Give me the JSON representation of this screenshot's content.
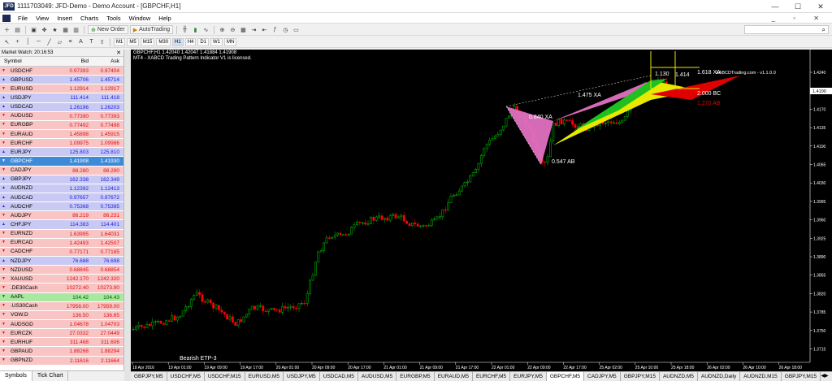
{
  "window": {
    "title": "1111703049: JFD-Demo - Demo Account - [GBPCHF,H1]",
    "logo": "JFD"
  },
  "menu": [
    "File",
    "View",
    "Insert",
    "Charts",
    "Tools",
    "Window",
    "Help"
  ],
  "toolbar1": {
    "new_order": "New Order",
    "auto_trading": "AutoTrading"
  },
  "toolbar2": {
    "timeframes": [
      "M1",
      "M5",
      "M15",
      "M30",
      "H1",
      "H4",
      "D1",
      "W1",
      "MN"
    ],
    "active_timeframe": "H1"
  },
  "market_watch": {
    "title": "Market Watch: 20:16:53",
    "headers": {
      "symbol": "Symbol",
      "bid": "Bid",
      "ask": "Ask"
    },
    "rows": [
      {
        "symbol": "USDCHF",
        "bid": "0.97393",
        "ask": "0.97404",
        "dir": "down"
      },
      {
        "symbol": "GBPUSD",
        "bid": "1.45706",
        "ask": "1.45714",
        "dir": "up"
      },
      {
        "symbol": "EURUSD",
        "bid": "1.12914",
        "ask": "1.12917",
        "dir": "down"
      },
      {
        "symbol": "USDJPY",
        "bid": "111.414",
        "ask": "111.418",
        "dir": "up"
      },
      {
        "symbol": "USDCAD",
        "bid": "1.26196",
        "ask": "1.26203",
        "dir": "up"
      },
      {
        "symbol": "AUDUSD",
        "bid": "0.77390",
        "ask": "0.77393",
        "dir": "down"
      },
      {
        "symbol": "EURGBP",
        "bid": "0.77492",
        "ask": "0.77498",
        "dir": "down"
      },
      {
        "symbol": "EURAUD",
        "bid": "1.45898",
        "ask": "1.45915",
        "dir": "down"
      },
      {
        "symbol": "EURCHF",
        "bid": "1.09975",
        "ask": "1.09986",
        "dir": "down"
      },
      {
        "symbol": "EURJPY",
        "bid": "125.803",
        "ask": "125.810",
        "dir": "up"
      },
      {
        "symbol": "GBPCHF",
        "bid": "1.41908",
        "ask": "1.41930",
        "dir": "sel"
      },
      {
        "symbol": "CADJPY",
        "bid": "88.280",
        "ask": "88.290",
        "dir": "down"
      },
      {
        "symbol": "GBPJPY",
        "bid": "162.338",
        "ask": "162.349",
        "dir": "up"
      },
      {
        "symbol": "AUDNZD",
        "bid": "1.12392",
        "ask": "1.12413",
        "dir": "up"
      },
      {
        "symbol": "AUDCAD",
        "bid": "0.97657",
        "ask": "0.97672",
        "dir": "up"
      },
      {
        "symbol": "AUDCHF",
        "bid": "0.75368",
        "ask": "0.75385",
        "dir": "up"
      },
      {
        "symbol": "AUDJPY",
        "bid": "86.219",
        "ask": "86.231",
        "dir": "down"
      },
      {
        "symbol": "CHFJPY",
        "bid": "114.383",
        "ask": "114.401",
        "dir": "up"
      },
      {
        "symbol": "EURNZD",
        "bid": "1.63995",
        "ask": "1.64031",
        "dir": "down"
      },
      {
        "symbol": "EURCAD",
        "bid": "1.42493",
        "ask": "1.42507",
        "dir": "down"
      },
      {
        "symbol": "CADCHF",
        "bid": "0.77171",
        "ask": "0.77185",
        "dir": "down"
      },
      {
        "symbol": "NZDJPY",
        "bid": "76.688",
        "ask": "76.698",
        "dir": "up"
      },
      {
        "symbol": "NZDUSD",
        "bid": "0.68845",
        "ask": "0.68854",
        "dir": "down"
      },
      {
        "symbol": "XAUUSD",
        "bid": "1242.170",
        "ask": "1242.320",
        "dir": "down"
      },
      {
        "symbol": ".DE30Cash",
        "bid": "10272.40",
        "ask": "10273.90",
        "dir": "down"
      },
      {
        "symbol": "AAPL",
        "bid": "104.42",
        "ask": "104.43",
        "dir": "green"
      },
      {
        "symbol": ".US30Cash",
        "bid": "17958.00",
        "ask": "17959.00",
        "dir": "down"
      },
      {
        "symbol": "VOW.D",
        "bid": "136.50",
        "ask": "136.65",
        "dir": "down"
      },
      {
        "symbol": "AUDSGD",
        "bid": "1.04678",
        "ask": "1.04703",
        "dir": "down"
      },
      {
        "symbol": "EURCZK",
        "bid": "27.0332",
        "ask": "27.0449",
        "dir": "down"
      },
      {
        "symbol": "EURHUF",
        "bid": "311.468",
        "ask": "311.606",
        "dir": "down"
      },
      {
        "symbol": "GBPAUD",
        "bid": "1.88268",
        "ask": "1.88294",
        "dir": "down"
      },
      {
        "symbol": "GBPNZD",
        "bid": "2.11616",
        "ask": "2.11664",
        "dir": "down"
      }
    ],
    "tabs": [
      "Symbols",
      "Tick Chart"
    ]
  },
  "chart": {
    "header": "GBPCHF,H1  1.42040 1.42047 1.41884 1.41908",
    "indicator_note": "MT4 - XABCD Trading Pattern Indicator V1 is licensed.",
    "watermark": "XABCDTrading.com - v1.1.0.0",
    "pattern_label": "Bearish ETP-3",
    "current_price": "1.4190",
    "fib_labels": [
      "1.475 XA",
      "0.840 XA",
      "0.547 AB",
      "1.130",
      "1.618 XA",
      "1.414",
      "2.000 BC",
      "1.270 AB"
    ],
    "price_axis": [
      "1.4240",
      "1.4205",
      "1.4170",
      "1.4135",
      "1.4100",
      "1.4065",
      "1.4030",
      "1.3995",
      "1.3960",
      "1.3925",
      "1.3890",
      "1.3855",
      "1.3820",
      "1.3785",
      "1.3750",
      "1.3715"
    ],
    "time_axis": [
      "18 Apr 2016",
      "19 Apr 01:00",
      "19 Apr 09:00",
      "19 Apr 17:00",
      "20 Apr 01:00",
      "20 Apr 09:00",
      "20 Apr 17:00",
      "21 Apr 01:00",
      "21 Apr 09:00",
      "21 Apr 17:00",
      "22 Apr 01:00",
      "22 Apr 09:00",
      "22 Apr 17:00",
      "25 Apr 02:00",
      "25 Apr 10:00",
      "25 Apr 18:00",
      "26 Apr 02:00",
      "26 Apr 10:00",
      "26 Apr 18:00"
    ],
    "colors": {
      "up": "#00c800",
      "down": "#ff0000",
      "bg": "#000000",
      "pattern_pink": "#e070c0",
      "pattern_yellow": "#e8e800",
      "pattern_red": "#e00000",
      "pattern_green": "#20c020"
    }
  },
  "chart_tabs": [
    "GBPJPY,M5",
    "USDCHF,M5",
    "USDCHF,M15",
    "EURUSD,M5",
    "USDJPY,M5",
    "USDCAD,M5",
    "AUDUSD,M5",
    "EURGBP,M5",
    "EURAUD,M5",
    "EURCHF,M5",
    "EURJPY,M5",
    "GBPCHF,M5",
    "CADJPY,M5",
    "GBPJPY,M15",
    "AUDNZD,M5",
    "AUDNZD,Daily",
    "AUDNZD,M15",
    "GBPJPY,M15"
  ],
  "active_chart_tab": "GBPCHF,M5"
}
